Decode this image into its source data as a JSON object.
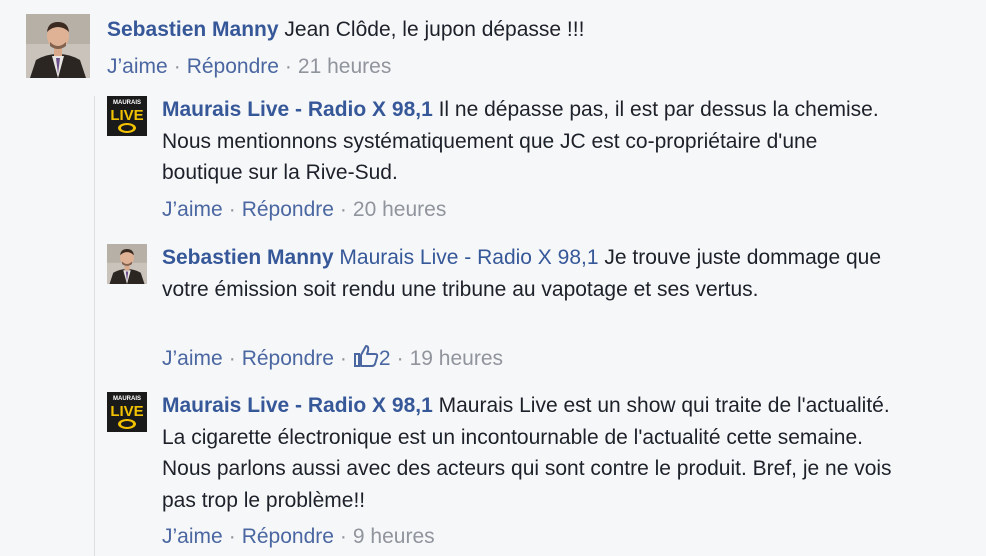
{
  "comments": [
    {
      "author": "Sebastien Manny",
      "mention": "",
      "text": " Jean Clôde, le jupon dépasse !!!",
      "like": "J’aime",
      "reply": "Répondre",
      "likes": "",
      "time": "21 heures",
      "avatar": "person"
    },
    {
      "author": "Maurais Live - Radio X 98,1",
      "mention": "",
      "text": " Il ne dépasse pas, il est par dessus la chemise. Nous mentionnons systématiquement que JC est co-propriétaire d'une boutique sur la Rive-Sud.",
      "like": "J’aime",
      "reply": "Répondre",
      "likes": "",
      "time": "20 heures",
      "avatar": "logo"
    },
    {
      "author": "Sebastien Manny",
      "mention": " Maurais Live - Radio X 98,1",
      "text": " Je trouve juste dommage que votre émission soit rendu une tribune au vapotage et ses vertus.",
      "like": "J’aime",
      "reply": "Répondre",
      "likes": "2",
      "time": "19 heures",
      "avatar": "person"
    },
    {
      "author": "Maurais Live - Radio X 98,1",
      "mention": "",
      "text": " Maurais Live est un show qui traite de l'actualité. La cigarette électronique est un incontournable de l'actualité cette semaine. Nous parlons aussi avec des acteurs qui sont contre le produit. Bref, je ne vois pas trop le problème!!",
      "like": "J’aime",
      "reply": "Répondre",
      "likes": "",
      "time": "9 heures",
      "avatar": "logo"
    }
  ],
  "logo_text": {
    "top": "MAURAIS",
    "main": "LIVE"
  },
  "separator": "·",
  "colors": {
    "author": "#365899",
    "meta": "#90949c",
    "link": "#4b67a1",
    "background": "#f6f7f9"
  },
  "icons": {
    "like_count": "thumbs-up-icon"
  }
}
